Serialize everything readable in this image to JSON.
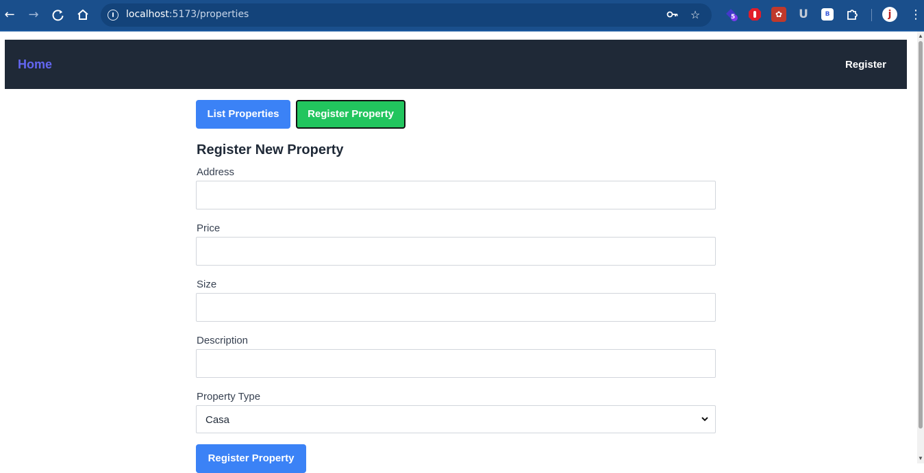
{
  "browser": {
    "url_host": "localhost",
    "url_rest": ":5173/properties",
    "extension_badge": "5"
  },
  "navbar": {
    "home_label": "Home",
    "register_label": "Register"
  },
  "tabs": {
    "list_label": "List Properties",
    "register_label": "Register Property"
  },
  "form": {
    "title": "Register New Property",
    "address_label": "Address",
    "price_label": "Price",
    "size_label": "Size",
    "description_label": "Description",
    "property_type_label": "Property Type",
    "property_type_value": "Casa",
    "submit_label": "Register Property"
  },
  "colors": {
    "chrome": "#1a4f8c",
    "navbar": "#1f2937",
    "home_link": "#6366f1",
    "primary": "#3b82f6",
    "success": "#22c55e"
  }
}
